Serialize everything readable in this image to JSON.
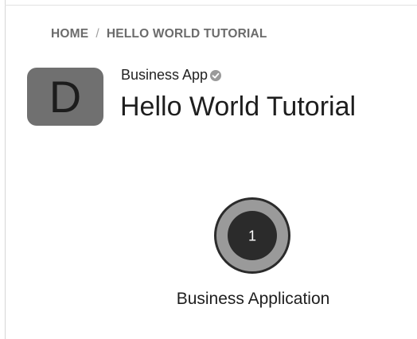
{
  "breadcrumb": {
    "items": [
      {
        "label": "HOME"
      },
      {
        "label": "HELLO WORLD TUTORIAL"
      }
    ],
    "separator": "/"
  },
  "header": {
    "icon_letter": "D",
    "type_label": "Business App",
    "verified_icon": "check-circle-icon",
    "title": "Hello World Tutorial"
  },
  "diagram": {
    "node": {
      "count": "1",
      "label": "Business Application"
    }
  },
  "colors": {
    "icon_bg": "#707070",
    "node_ring": "#9a9a9a",
    "node_core": "#2b2b2b",
    "breadcrumb_text": "#6b6b6b"
  }
}
